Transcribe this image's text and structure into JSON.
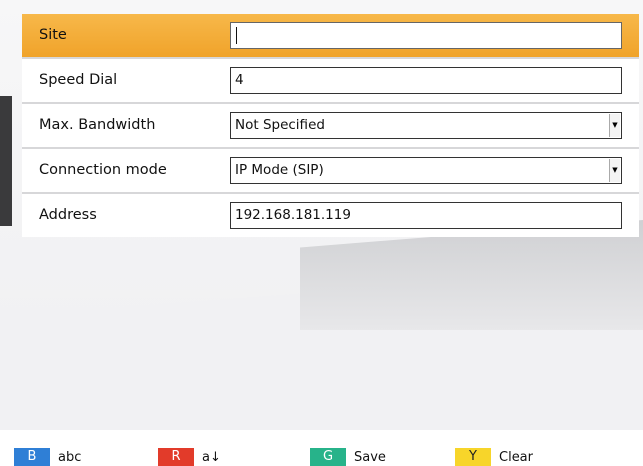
{
  "form": {
    "rows": [
      {
        "label": "Site",
        "value": ""
      },
      {
        "label": "Speed Dial",
        "value": "4"
      },
      {
        "label": "Max. Bandwidth",
        "value": "Not Specified"
      },
      {
        "label": "Connection mode",
        "value": "IP Mode (SIP)"
      },
      {
        "label": "Address",
        "value": "192.168.181.119"
      }
    ]
  },
  "footer": {
    "keys": [
      {
        "chip": "B",
        "label": "abc",
        "color": "#2f7fd6"
      },
      {
        "chip": "R",
        "label": "a↓",
        "color": "#e23b2a"
      },
      {
        "chip": "G",
        "label": "Save",
        "color": "#27b38a"
      },
      {
        "chip": "Y",
        "label": "Clear",
        "color": "#f7d52a"
      }
    ]
  },
  "accent_color": "#f0a32a"
}
